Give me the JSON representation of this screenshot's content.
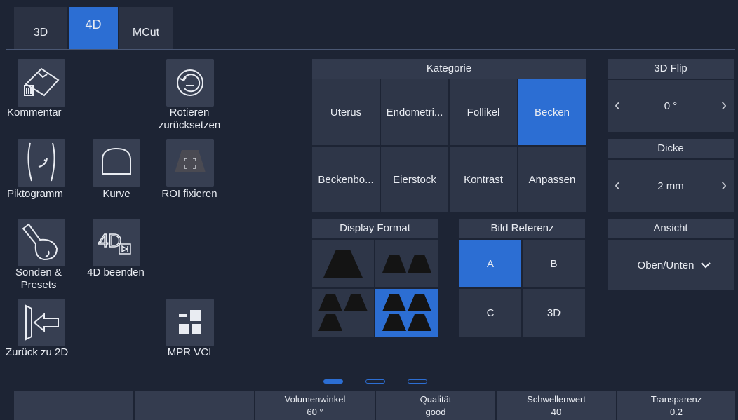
{
  "tabs": [
    {
      "label": "3D"
    },
    {
      "label": "4D"
    },
    {
      "label": "MCut"
    }
  ],
  "tools": {
    "kommentar": "Kommentar",
    "rotieren": "Rotieren\nzurücksetzen",
    "piktogramm": "Piktogramm",
    "kurve": "Kurve",
    "roi": "ROI fixieren",
    "sonden": "Sonden &\nPresets",
    "beenden": "4D beenden",
    "zurueck": "Zurück zu 2D",
    "mpr": "MPR VCI"
  },
  "kategorie": {
    "title": "Kategorie",
    "items": [
      "Uterus",
      "Endometri...",
      "Follikel",
      "Becken",
      "Beckenbo...",
      "Eierstock",
      "Kontrast",
      "Anpassen"
    ],
    "selected": "Becken"
  },
  "flip": {
    "title": "3D Flip",
    "value": "0 °"
  },
  "dicke": {
    "title": "Dicke",
    "value": "2 mm"
  },
  "display_format": {
    "title": "Display Format"
  },
  "bild_referenz": {
    "title": "Bild Referenz",
    "items": [
      "A",
      "B",
      "C",
      "3D"
    ],
    "selected": "A"
  },
  "ansicht": {
    "title": "Ansicht",
    "value": "Oben/Unten"
  },
  "bottom": [
    {
      "label": "",
      "value": ""
    },
    {
      "label": "",
      "value": ""
    },
    {
      "label": "Volumenwinkel",
      "value": "60 °"
    },
    {
      "label": "Qualität",
      "value": "good"
    },
    {
      "label": "Schwellenwert",
      "value": "40"
    },
    {
      "label": "Transparenz",
      "value": "0.2"
    }
  ],
  "colors": {
    "accent": "#2c6ed3",
    "background": "#1d2434",
    "panel": "#2e3648"
  }
}
